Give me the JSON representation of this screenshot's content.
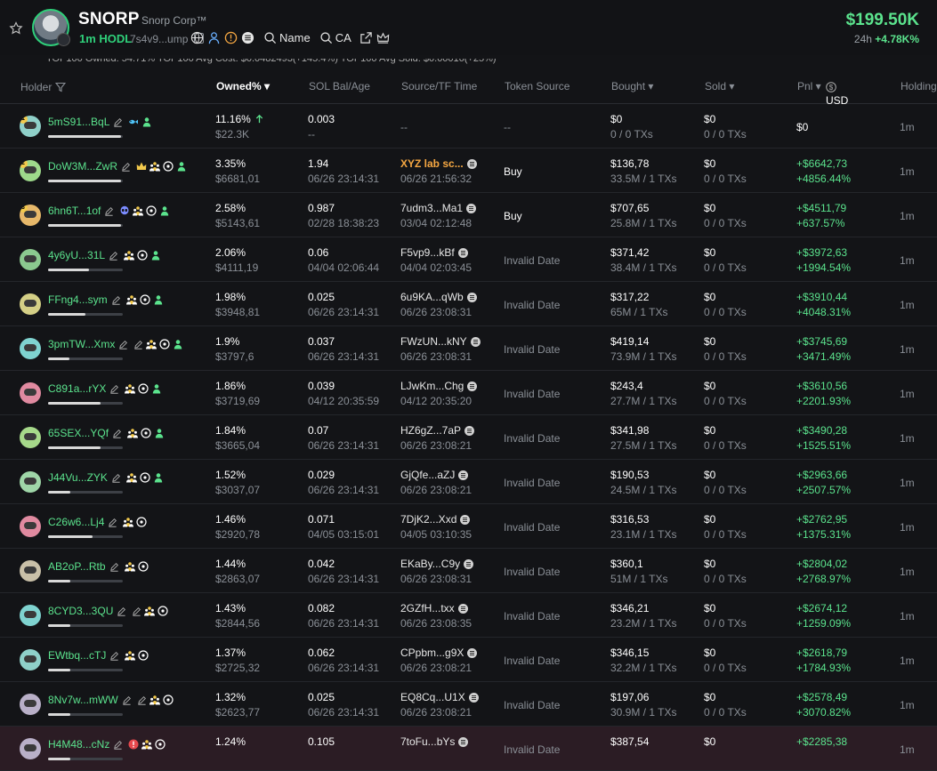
{
  "header": {
    "token_symbol": "SNORP",
    "token_name": "Snorp Corp™",
    "hodl_label": "1m HODL",
    "address": "7s4v9...ump",
    "search_name": "Name",
    "search_ca": "CA",
    "price": "$199.50K",
    "change_period": "24h",
    "change_value": "+4.78K%"
  },
  "summary": "TOP100 Owned: 54.71%   TOP100 Avg Cost: $0.0482493(+145.4%)   TOP100 Avg Sold: $0.00016(+25%)",
  "columns": {
    "holder": "Holder",
    "owned": "Owned% ▾",
    "sol": "SOL Bal/Age",
    "source": "Source/TF Time",
    "token_source": "Token Source",
    "bought": "Bought ▾",
    "sold": "Sold ▾",
    "pnl": "Pnl ▾",
    "usd": "USD",
    "holding": "Holding"
  },
  "colors": {
    "green": "#5be38d",
    "orange": "#f5a742"
  },
  "rows": [
    {
      "holder": "5mS91...BqL",
      "icons": [
        "fish-icon",
        "user-icon"
      ],
      "bar": 0.98,
      "owned": "11.16%",
      "owned_usd": "$22.3K",
      "sol": "0.003",
      "age": "--",
      "source": "",
      "tf": "",
      "dash": "--",
      "token_source": "--",
      "bought": "$0",
      "bought_tx": "0 / 0 TXs",
      "sold": "$0",
      "sold_tx": "0 / 0 TXs",
      "pnl": "$0",
      "pnl_pct": "",
      "holding": "1m",
      "ava": "#8fd0c9",
      "rank": "1",
      "arrow": true
    },
    {
      "holder": "DoW3M...ZwR",
      "icons": [
        "crown-icon",
        "crowd-icon",
        "target-icon",
        "user-icon"
      ],
      "bar": 0.98,
      "owned": "3.35%",
      "owned_usd": "$6681,01",
      "sol": "1.94",
      "age": "06/26 23:14:31",
      "source": "XYZ lab sc...",
      "tf": "06/26 21:56:32",
      "token_source": "Buy",
      "bought": "$136,78",
      "bought_tx": "33.5M / 1 TXs",
      "sold": "$0",
      "sold_tx": "0 / 0 TXs",
      "pnl": "+$6642,73",
      "pnl_pct": "+4856.44%",
      "holding": "1m",
      "ava": "#9ed98b",
      "rank": "2",
      "xyz": true
    },
    {
      "holder": "6hn6T...1of",
      "icons": [
        "alien-icon",
        "crowd-icon",
        "target-icon",
        "user-icon"
      ],
      "bar": 0.98,
      "owned": "2.58%",
      "owned_usd": "$5143,61",
      "sol": "0.987",
      "age": "02/28 18:38:23",
      "source": "7udm3...Ma1",
      "tf": "03/04 02:12:48",
      "token_source": "Buy",
      "bought": "$707,65",
      "bought_tx": "25.8M / 1 TXs",
      "sold": "$0",
      "sold_tx": "0 / 0 TXs",
      "pnl": "+$4511,79",
      "pnl_pct": "+637.57%",
      "holding": "1m",
      "ava": "#e7b86a",
      "rank": "3"
    },
    {
      "holder": "4y6yU...31L",
      "icons": [
        "crowd-icon",
        "target-icon",
        "user-icon"
      ],
      "bar": 0.55,
      "owned": "2.06%",
      "owned_usd": "$4111,19",
      "sol": "0.06",
      "age": "04/04 02:06:44",
      "source": "F5vp9...kBf",
      "tf": "04/04 02:03:45",
      "token_source": "Invalid Date",
      "bought": "$371,42",
      "bought_tx": "38.4M / 1 TXs",
      "sold": "$0",
      "sold_tx": "0 / 0 TXs",
      "pnl": "+$3972,63",
      "pnl_pct": "+1994.54%",
      "holding": "1m",
      "ava": "#8bc98f"
    },
    {
      "holder": "FFng4...sym",
      "icons": [
        "crowd-icon",
        "target-icon",
        "user-icon"
      ],
      "bar": 0.5,
      "owned": "1.98%",
      "owned_usd": "$3948,81",
      "sol": "0.025",
      "age": "06/26 23:14:31",
      "source": "6u9KA...qWb",
      "tf": "06/26 23:08:31",
      "token_source": "Invalid Date",
      "bought": "$317,22",
      "bought_tx": "65M / 1 TXs",
      "sold": "$0",
      "sold_tx": "0 / 0 TXs",
      "pnl": "+$3910,44",
      "pnl_pct": "+4048.31%",
      "holding": "1m",
      "ava": "#d4cf86"
    },
    {
      "holder": "3pmTW...Xmx",
      "icons": [
        "crowd-icon",
        "target-icon",
        "user-icon"
      ],
      "bar": 0.28,
      "owned": "1.9%",
      "owned_usd": "$3797,6",
      "sol": "0.037",
      "age": "06/26 23:14:31",
      "source": "FWzUN...kNY",
      "tf": "06/26 23:08:31",
      "token_source": "Invalid Date",
      "bought": "$419,14",
      "bought_tx": "73.9M / 1 TXs",
      "sold": "$0",
      "sold_tx": "0 / 0 TXs",
      "pnl": "+$3745,69",
      "pnl_pct": "+3471.49%",
      "holding": "1m",
      "ava": "#7fd3d0",
      "edit2": true
    },
    {
      "holder": "C891a...rYX",
      "icons": [
        "crowd-icon",
        "target-icon",
        "user-icon"
      ],
      "bar": 0.7,
      "owned": "1.86%",
      "owned_usd": "$3719,69",
      "sol": "0.039",
      "age": "04/12 20:35:59",
      "source": "LJwKm...Chg",
      "tf": "04/12 20:35:20",
      "token_source": "Invalid Date",
      "bought": "$243,4",
      "bought_tx": "27.7M / 1 TXs",
      "sold": "$0",
      "sold_tx": "0 / 0 TXs",
      "pnl": "+$3610,56",
      "pnl_pct": "+2201.93%",
      "holding": "1m",
      "ava": "#e08aa0"
    },
    {
      "holder": "65SEX...YQf",
      "icons": [
        "crowd-icon",
        "target-icon",
        "user-icon"
      ],
      "bar": 0.7,
      "owned": "1.84%",
      "owned_usd": "$3665,04",
      "sol": "0.07",
      "age": "06/26 23:14:31",
      "source": "HZ6gZ...7aP",
      "tf": "06/26 23:08:21",
      "token_source": "Invalid Date",
      "bought": "$341,98",
      "bought_tx": "27.5M / 1 TXs",
      "sold": "$0",
      "sold_tx": "0 / 0 TXs",
      "pnl": "+$3490,28",
      "pnl_pct": "+1525.51%",
      "holding": "1m",
      "ava": "#a6d98a"
    },
    {
      "holder": "J44Vu...ZYK",
      "icons": [
        "crowd-icon",
        "target-icon",
        "user-icon"
      ],
      "bar": 0.3,
      "owned": "1.52%",
      "owned_usd": "$3037,07",
      "sol": "0.029",
      "age": "06/26 23:14:31",
      "source": "GjQfe...aZJ",
      "tf": "06/26 23:08:21",
      "token_source": "Invalid Date",
      "bought": "$190,53",
      "bought_tx": "24.5M / 1 TXs",
      "sold": "$0",
      "sold_tx": "0 / 0 TXs",
      "pnl": "+$2963,66",
      "pnl_pct": "+2507.57%",
      "holding": "1m",
      "ava": "#9fd6a8"
    },
    {
      "holder": "C26w6...Lj4",
      "icons": [
        "crowd-icon",
        "target-icon"
      ],
      "bar": 0.6,
      "owned": "1.46%",
      "owned_usd": "$2920,78",
      "sol": "0.071",
      "age": "04/05 03:15:01",
      "source": "7DjK2...Xxd",
      "tf": "04/05 03:10:35",
      "token_source": "Invalid Date",
      "bought": "$316,53",
      "bought_tx": "23.1M / 1 TXs",
      "sold": "$0",
      "sold_tx": "0 / 0 TXs",
      "pnl": "+$2762,95",
      "pnl_pct": "+1375.31%",
      "holding": "1m",
      "ava": "#e08aa0"
    },
    {
      "holder": "AB2oP...Rtb",
      "icons": [
        "crowd-icon",
        "target-icon"
      ],
      "bar": 0.3,
      "owned": "1.44%",
      "owned_usd": "$2863,07",
      "sol": "0.042",
      "age": "06/26 23:14:31",
      "source": "EKaBy...C9y",
      "tf": "06/26 23:08:31",
      "token_source": "Invalid Date",
      "bought": "$360,1",
      "bought_tx": "51M / 1 TXs",
      "sold": "$0",
      "sold_tx": "0 / 0 TXs",
      "pnl": "+$2804,02",
      "pnl_pct": "+2768.97%",
      "holding": "1m",
      "ava": "#c9c0a8"
    },
    {
      "holder": "8CYD3...3QU",
      "icons": [
        "crowd-icon",
        "target-icon"
      ],
      "bar": 0.3,
      "owned": "1.43%",
      "owned_usd": "$2844,56",
      "sol": "0.082",
      "age": "06/26 23:14:31",
      "source": "2GZfH...txx",
      "tf": "06/26 23:08:35",
      "token_source": "Invalid Date",
      "bought": "$346,21",
      "bought_tx": "23.2M / 1 TXs",
      "sold": "$0",
      "sold_tx": "0 / 0 TXs",
      "pnl": "+$2674,12",
      "pnl_pct": "+1259.09%",
      "holding": "1m",
      "ava": "#7fd3d0",
      "edit2": true
    },
    {
      "holder": "EWtbq...cTJ",
      "icons": [
        "crowd-icon",
        "target-icon"
      ],
      "bar": 0.3,
      "owned": "1.37%",
      "owned_usd": "$2725,32",
      "sol": "0.062",
      "age": "06/26 23:14:31",
      "source": "CPpbm...g9X",
      "tf": "06/26 23:08:21",
      "token_source": "Invalid Date",
      "bought": "$346,15",
      "bought_tx": "32.2M / 1 TXs",
      "sold": "$0",
      "sold_tx": "0 / 0 TXs",
      "pnl": "+$2618,79",
      "pnl_pct": "+1784.93%",
      "holding": "1m",
      "ava": "#8fd0c9"
    },
    {
      "holder": "8Nv7w...mWW",
      "icons": [
        "crowd-icon",
        "target-icon"
      ],
      "bar": 0.3,
      "owned": "1.32%",
      "owned_usd": "$2623,77",
      "sol": "0.025",
      "age": "06/26 23:14:31",
      "source": "EQ8Cq...U1X",
      "tf": "06/26 23:08:21",
      "token_source": "Invalid Date",
      "bought": "$197,06",
      "bought_tx": "30.9M / 1 TXs",
      "sold": "$0",
      "sold_tx": "0 / 0 TXs",
      "pnl": "+$2578,49",
      "pnl_pct": "+3070.82%",
      "holding": "1m",
      "ava": "#b9b0c8",
      "edit2": true
    },
    {
      "holder": "H4M48...cNz",
      "icons": [
        "alert-icon",
        "crowd-icon",
        "target-icon"
      ],
      "bar": 0.3,
      "owned": "1.24%",
      "owned_usd": "",
      "sol": "0.105",
      "age": "",
      "source": "7toFu...bYs",
      "tf": "",
      "token_source": "Invalid Date",
      "bought": "$387,54",
      "bought_tx": "",
      "sold": "$0",
      "sold_tx": "",
      "pnl": "+$2285,38",
      "pnl_pct": "",
      "holding": "1m",
      "ava": "#b9b0c8",
      "highlight": true
    }
  ]
}
